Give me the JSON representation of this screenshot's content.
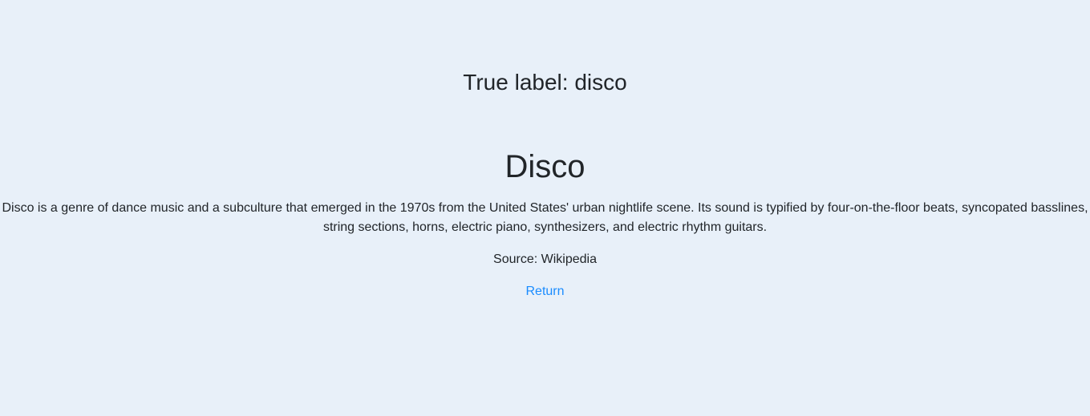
{
  "true_label": "True label: disco",
  "genre_title": "Disco",
  "description": "Disco is a genre of dance music and a subculture that emerged in the 1970s from the United States' urban nightlife scene. Its sound is typified by four-on-the-floor beats, syncopated basslines, string sections, horns, electric piano, synthesizers, and electric rhythm guitars.",
  "source": "Source: Wikipedia",
  "return_link": "Return"
}
